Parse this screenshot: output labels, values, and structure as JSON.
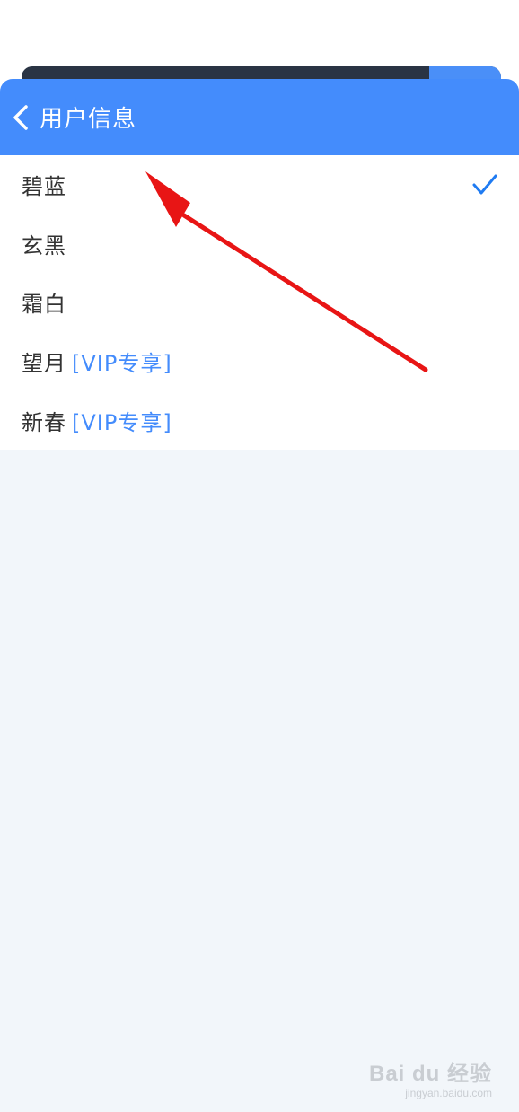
{
  "header": {
    "title": "用户信息",
    "back_icon": "chevron-left-icon",
    "background": "#448cfc"
  },
  "themes": [
    {
      "label": "碧蓝",
      "tag": "",
      "selected": true
    },
    {
      "label": "玄黑",
      "tag": "",
      "selected": false
    },
    {
      "label": "霜白",
      "tag": "",
      "selected": false
    },
    {
      "label": "望月",
      "tag": "[VIP专享]",
      "selected": false
    },
    {
      "label": "新春",
      "tag": "[VIP专享]",
      "selected": false
    }
  ],
  "check_color": "#1f7bf2",
  "annotation": {
    "arrow_color": "#e81515"
  },
  "watermark": {
    "logo": "Bai du 经验",
    "url": "jingyan.baidu.com"
  }
}
